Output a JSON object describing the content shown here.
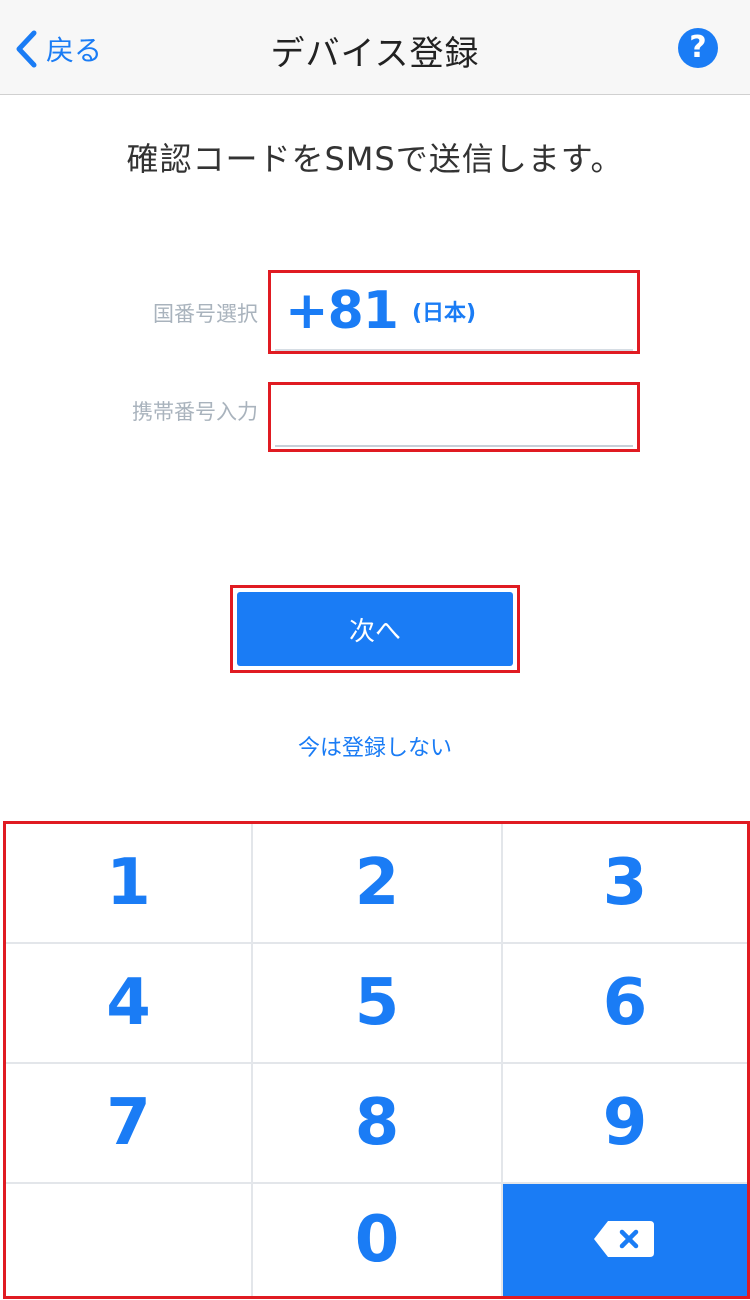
{
  "nav": {
    "back_label": "戻る",
    "title": "デバイス登録",
    "help_symbol": "?"
  },
  "instruction": "確認コードをSMSで送信します。",
  "form": {
    "country_label": "国番号選択",
    "country_code": "+81",
    "country_name": "(日本)",
    "phone_label": "携帯番号入力",
    "phone_value": ""
  },
  "next_button": "次へ",
  "skip_link": "今は登録しない",
  "keypad": {
    "keys": [
      "1",
      "2",
      "3",
      "4",
      "5",
      "6",
      "7",
      "8",
      "9",
      "",
      "0"
    ],
    "delete_icon": "backspace-icon"
  },
  "colors": {
    "accent": "#1a7cf5",
    "highlight_border": "#e01b22"
  }
}
